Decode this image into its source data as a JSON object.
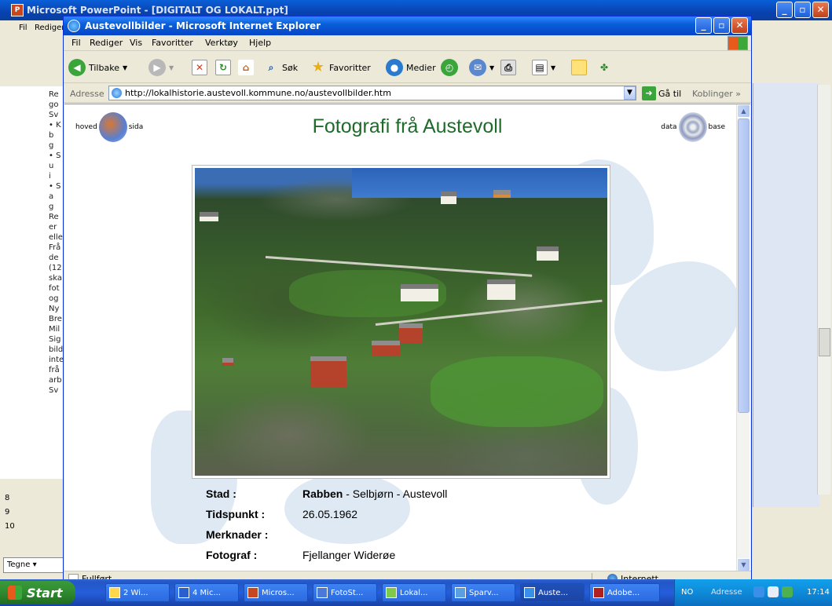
{
  "background_app": {
    "title": "Microsoft PowerPoint - [DIGITALT OG LOKALT.ppt]",
    "menu_first": "Fil",
    "menu_second": "Rediger",
    "left_text": [
      "Re",
      "go",
      "Sv",
      "• K",
      "b",
      "g",
      "• S",
      "u",
      "i",
      "• S",
      "a",
      "g",
      "Re",
      "er",
      "elle",
      "Frå",
      "de",
      "(12",
      "ska",
      "fot",
      "og",
      "Ny",
      "Bre",
      "Mil",
      "Sig",
      "bild",
      "inte",
      "frå",
      "arb",
      "Sv"
    ],
    "slide_numbers": [
      "8",
      "9",
      "10"
    ],
    "tegne_label": "Tegne ▾"
  },
  "ie": {
    "title": "Austevollbilder - Microsoft Internet Explorer",
    "menus": [
      "Fil",
      "Rediger",
      "Vis",
      "Favoritter",
      "Verktøy",
      "Hjelp"
    ],
    "toolbar": {
      "back": "Tilbake",
      "search": "Søk",
      "favorites": "Favoritter",
      "media": "Medier"
    },
    "address_label": "Adresse",
    "address_url": "http://lokalhistorie.austevoll.kommune.no/austevollbilder.htm",
    "go_label": "Gå til",
    "links_label": "Koblinger",
    "status_left": "Fullført",
    "status_right": "Internett"
  },
  "page": {
    "title": "Fotografi frå Austevoll",
    "logo_left_a": "hoved",
    "logo_left_b": "sida",
    "logo_right_a": "data",
    "logo_right_b": "base",
    "meta": {
      "stad_label": "Stad  :",
      "stad_bold": "Rabben",
      "stad_rest": " - Selbjørn - Austevoll",
      "tid_label": "Tidspunkt  :",
      "tid_value": "26.05.1962",
      "merk_label": "Merknader  :",
      "merk_value": "",
      "foto_label": "Fotograf  :",
      "foto_value": "Fjellanger Widerøe"
    }
  },
  "taskbar": {
    "start": "Start",
    "tasks": [
      "2 Wi...",
      "4 Mic...",
      "Micros...",
      "FotoSt...",
      "Lokal...",
      "Sparv...",
      "Auste...",
      "Adobe..."
    ],
    "lang": "NO",
    "tray_address": "Adresse",
    "clock": "17:14"
  },
  "colors": {
    "title_green": "#1e6b2a",
    "xp_blue": "#0a5fd8"
  }
}
